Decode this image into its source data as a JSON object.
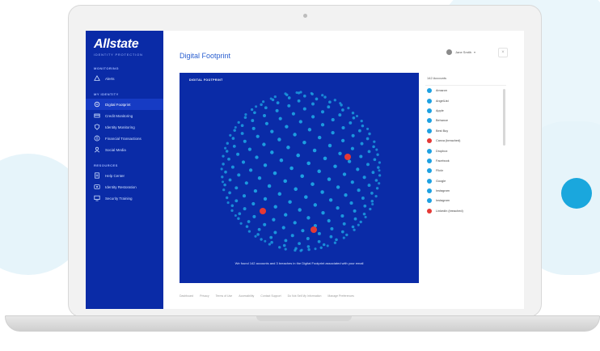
{
  "colors": {
    "brand_blue": "#0a2ba7",
    "accent_cyan": "#1aa7dd",
    "dot_blue": "#1da1e2",
    "alert_red": "#e53935",
    "title_blue": "#2a5fd0"
  },
  "brand": {
    "name": "Allstate",
    "subtitle": "IDENTITY PROTECTION"
  },
  "sidebar": {
    "sections": [
      {
        "title": "MONITORING",
        "items": [
          {
            "label": "Alerts",
            "icon": "alert-icon",
            "active": false
          }
        ]
      },
      {
        "title": "MY IDENTITY",
        "items": [
          {
            "label": "Digital Footprint",
            "icon": "footprint-icon",
            "active": true
          },
          {
            "label": "Credit Monitoring",
            "icon": "credit-card-icon",
            "active": false
          },
          {
            "label": "Identity Monitoring",
            "icon": "shield-icon",
            "active": false
          },
          {
            "label": "Financial Transactions",
            "icon": "dollar-icon",
            "active": false
          },
          {
            "label": "Social Media",
            "icon": "user-icon",
            "active": false
          }
        ]
      },
      {
        "title": "RESOURCES",
        "items": [
          {
            "label": "Help Center",
            "icon": "document-icon",
            "active": false
          },
          {
            "label": "Identity Restoration",
            "icon": "restore-icon",
            "active": false
          },
          {
            "label": "Security Training",
            "icon": "monitor-icon",
            "active": false
          }
        ]
      }
    ]
  },
  "header": {
    "title": "Digital Footprint",
    "user_name": "Jane Smith"
  },
  "footprint": {
    "label": "DIGITAL FOOTPRINT",
    "caption": "We found 142 accounts and 3 breaches in the Digital Footprint associated with your email"
  },
  "accounts": {
    "header": "142 Accounts",
    "items": [
      {
        "name": "Amazon",
        "status": "ok"
      },
      {
        "name": "AngelList",
        "status": "ok"
      },
      {
        "name": "Apple",
        "status": "ok"
      },
      {
        "name": "Behance",
        "status": "ok"
      },
      {
        "name": "Best Buy",
        "status": "ok"
      },
      {
        "name": "Canva (breached)",
        "status": "breach"
      },
      {
        "name": "Dropbox",
        "status": "ok"
      },
      {
        "name": "Facebook",
        "status": "ok"
      },
      {
        "name": "Flickr",
        "status": "ok"
      },
      {
        "name": "Google",
        "status": "ok"
      },
      {
        "name": "Instagram",
        "status": "ok"
      },
      {
        "name": "Instagram",
        "status": "ok"
      },
      {
        "name": "LinkedIn (breached)",
        "status": "breach"
      }
    ]
  },
  "footer": {
    "links": [
      "Dashboard",
      "Privacy",
      "Terms of Use",
      "Accessibility",
      "Contact Support",
      "Do Not Sell My Information",
      "Manage Preferences"
    ]
  }
}
